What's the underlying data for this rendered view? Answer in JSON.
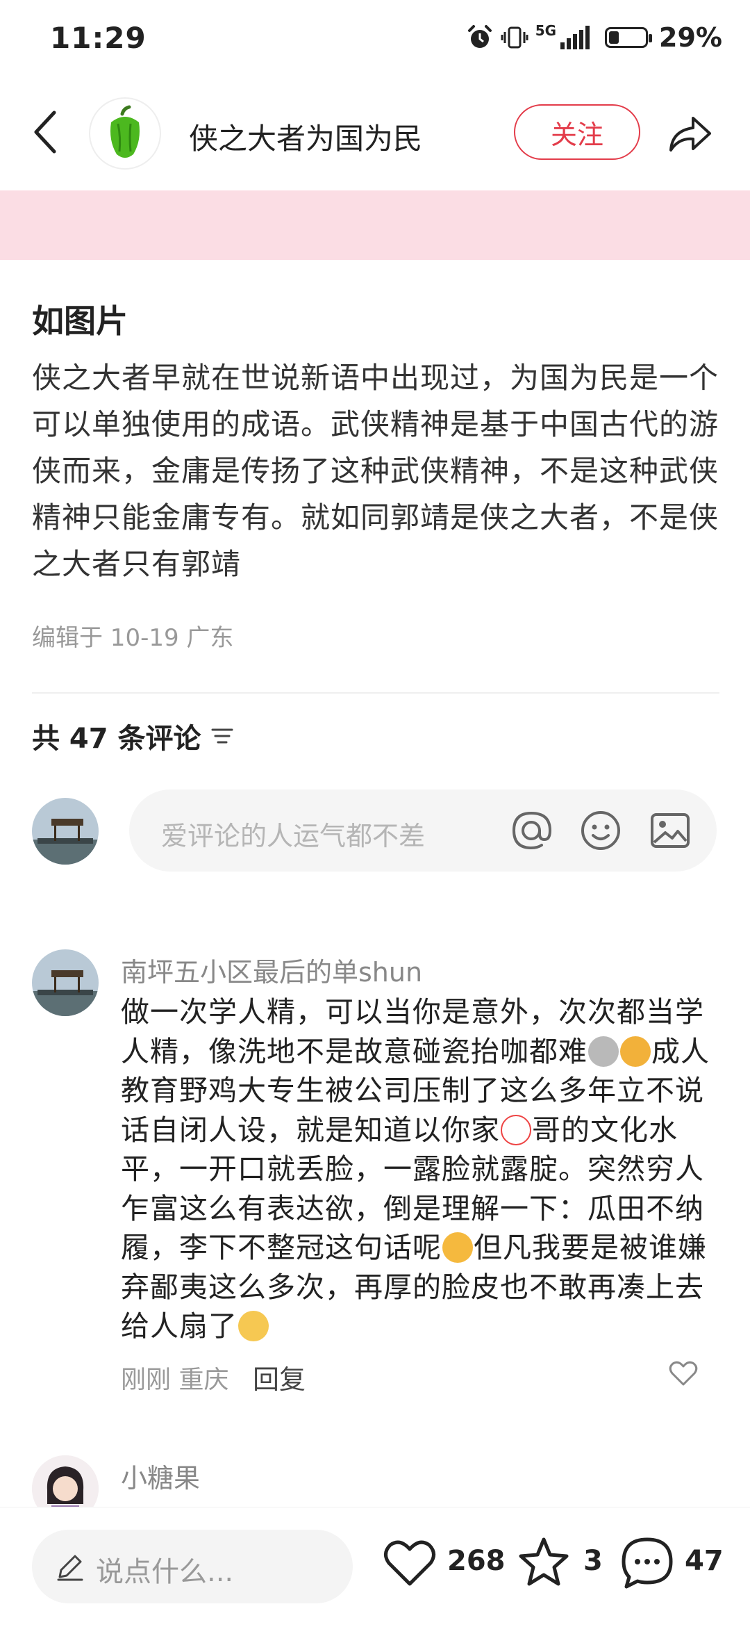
{
  "status_bar": {
    "time": "11:29",
    "network": "5G",
    "battery": "29%",
    "battery_level": 0.29
  },
  "header": {
    "title": "侠之大者为国为民",
    "follow_label": "关注"
  },
  "post": {
    "title": "如图片",
    "body": "侠之大者早就在世说新语中出现过，为国为民是一个可以单独使用的成语。武侠精神是基于中国古代的游侠而来，金庸是传扬了这种武侠精神，不是这种武侠精神只能金庸专有。就如同郭靖是侠之大者，不是侠之大者只有郭靖",
    "meta": "编辑于 10-19 广东"
  },
  "comments_section": {
    "count_label": "共 47 条评论",
    "input_placeholder": "爱评论的人运气都不差"
  },
  "comments": [
    {
      "name": "南坪五小区最后的单shun",
      "text_parts": [
        "做一次学人精，可以当你是意外，次次都当学人精，像洗地不是故意碰瓷抬咖都难",
        "成人教育野鸡大专生被公司压制了这么多年立不说话自闭人设，就是知道以你家",
        "哥的文化水平，一开口就丢脸，一露脸就露腚。突然穷人乍富这么有表达欲，倒是理解一下：瓜田不纳履，李下不整冠这句话呢",
        "但凡我要是被谁嫌弃鄙夷这么多次，再厚的脸皮也不敢再凑上去给人扇了"
      ],
      "time": "刚刚",
      "location": "重庆",
      "reply_label": "回复"
    },
    {
      "name": "小糖果"
    }
  ],
  "bottom_bar": {
    "say_placeholder": "说点什么...",
    "likes": "268",
    "stars": "3",
    "comments": "47"
  },
  "colors": {
    "accent": "#e33c4a",
    "banner": "#fbdde4",
    "input_bg": "#f5f5f5"
  },
  "icons": [
    "back-arrow-icon",
    "green-pepper-logo",
    "share-icon",
    "sort-icon",
    "at-icon",
    "emoji-icon",
    "image-icon",
    "like-heart-icon",
    "pencil-icon",
    "heart-icon",
    "star-icon",
    "comment-bubble-icon"
  ]
}
